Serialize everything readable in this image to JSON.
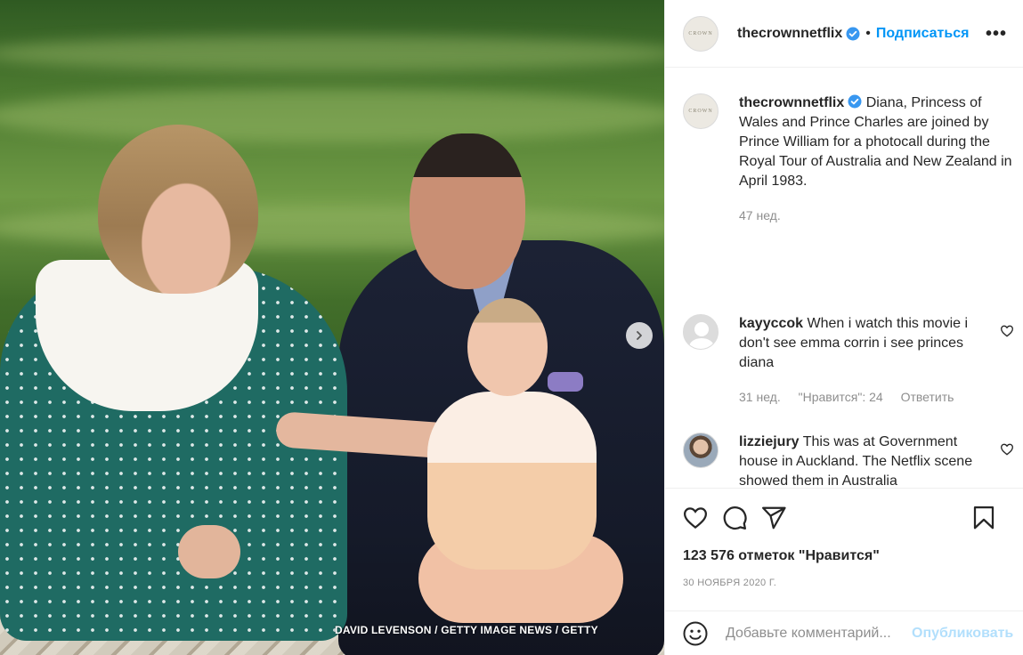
{
  "photo": {
    "credit": "DAVID LEVENSON / GETTY IMAGE NEWS / GETTY",
    "next_icon": "chevron-right-icon"
  },
  "header": {
    "username": "thecrownnetflix",
    "separator": "•",
    "follow_label": "Подписаться",
    "more_label": "•••",
    "avatar_text": "CROWN"
  },
  "caption": {
    "username": "thecrownnetflix",
    "text": "Diana, Princess of Wales and Prince Charles are joined by Prince William for a photocall during the Royal Tour of Australia and New Zealand in April 1983.",
    "age": "47 нед."
  },
  "comments": [
    {
      "username": "kayyccok",
      "text": "When i watch this movie i don't see emma corrin i see princes diana",
      "age": "31 нед.",
      "likes": "\"Нравится\": 24",
      "reply": "Ответить"
    },
    {
      "username": "lizziejury",
      "text": "This was at Government house in Auckland. The Netflix scene showed them in Australia"
    }
  ],
  "stats": {
    "likes": "123 576 отметок \"Нравится\"",
    "date": "30 НОЯБРЯ 2020 Г."
  },
  "composer": {
    "placeholder": "Добавьте комментарий...",
    "publish_label": "Опубликовать"
  },
  "colors": {
    "accent": "#0095f6",
    "publish_disabled": "#b2dffc",
    "muted": "#8e8e8e",
    "border": "#efefef"
  }
}
